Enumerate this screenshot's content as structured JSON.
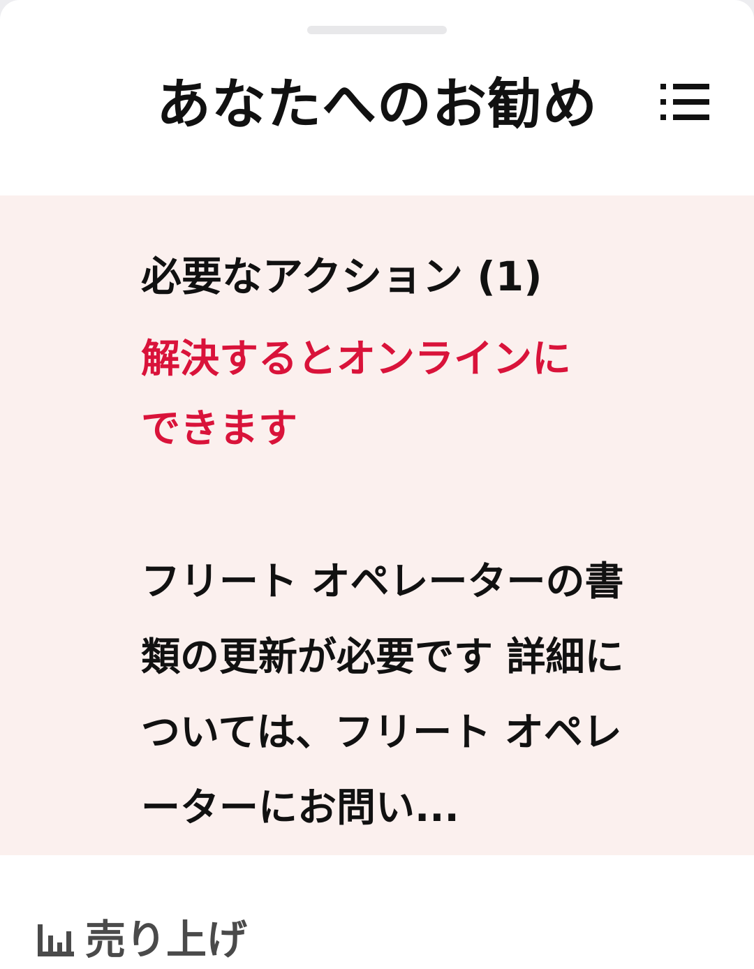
{
  "sheet": {
    "title": "あなたへのお勧め",
    "list_icon": "list-icon"
  },
  "card": {
    "title": "必要なアクション (1)",
    "subtitle": "解決するとオンラインにできます",
    "body": "フリート オペレーターの書類の更新が必要です 詳細については、フリート オペレーターにお問い..."
  },
  "bottom": {
    "sales_icon": "bar-chart-icon",
    "sales_label": "売り上げ"
  },
  "colors": {
    "card_background": "#fbf0ee",
    "accent_red": "#d9133a",
    "text_primary": "#111111",
    "text_secondary": "#4a4a4a"
  }
}
